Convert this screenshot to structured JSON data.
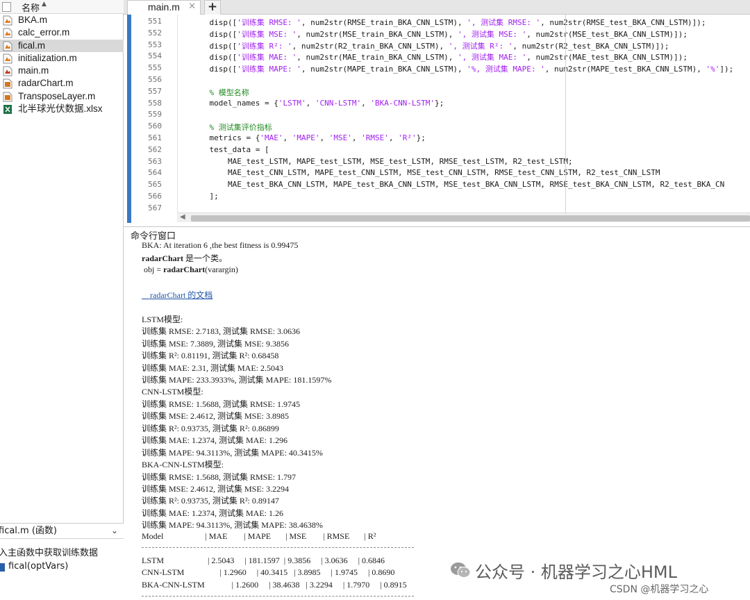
{
  "file_browser": {
    "header": "名称",
    "files": [
      {
        "name": "BKA.m",
        "icon": "matlab-file-icon"
      },
      {
        "name": "calc_error.m",
        "icon": "matlab-file-icon"
      },
      {
        "name": "fical.m",
        "icon": "matlab-file-icon",
        "selected": true
      },
      {
        "name": "initialization.m",
        "icon": "matlab-file-icon"
      },
      {
        "name": "main.m",
        "icon": "matlab-script-icon"
      },
      {
        "name": "radarChart.m",
        "icon": "matlab-class-icon"
      },
      {
        "name": "TransposeLayer.m",
        "icon": "matlab-class-icon"
      },
      {
        "name": "北半球光伏数据.xlsx",
        "icon": "excel-file-icon"
      }
    ]
  },
  "func_panel": {
    "title": "fical.m  (函数)",
    "description": "入主函数中获取训练数据",
    "signature": "fical(optVars)"
  },
  "editor": {
    "tab": "main.m",
    "add_tab": "+",
    "lines": [
      {
        "num": "551",
        "segs": [
          {
            "t": "    disp(["
          },
          {
            "t": "'训练集 RMSE: '",
            "c": "str"
          },
          {
            "t": ", num2str(RMSE_train_BKA_CNN_LSTM), "
          },
          {
            "t": "', 测试集 RMSE: '",
            "c": "str"
          },
          {
            "t": ", num2str(RMSE_test_BKA_CNN_LSTM)]);"
          }
        ]
      },
      {
        "num": "552",
        "segs": [
          {
            "t": "    disp(["
          },
          {
            "t": "'训练集 MSE: '",
            "c": "str"
          },
          {
            "t": ", num2str(MSE_train_BKA_CNN_LSTM), "
          },
          {
            "t": "', 测试集 MSE: '",
            "c": "str"
          },
          {
            "t": ", num2str(MSE_test_BKA_CNN_LSTM)]);"
          }
        ]
      },
      {
        "num": "553",
        "segs": [
          {
            "t": "    disp(["
          },
          {
            "t": "'训练集 R²: '",
            "c": "str"
          },
          {
            "t": ", num2str(R2_train_BKA_CNN_LSTM), "
          },
          {
            "t": "', 测试集 R²: '",
            "c": "str"
          },
          {
            "t": ", num2str(R2_test_BKA_CNN_LSTM)]);"
          }
        ]
      },
      {
        "num": "554",
        "segs": [
          {
            "t": "    disp(["
          },
          {
            "t": "'训练集 MAE: '",
            "c": "str"
          },
          {
            "t": ", num2str(MAE_train_BKA_CNN_LSTM), "
          },
          {
            "t": "', 测试集 MAE: '",
            "c": "str"
          },
          {
            "t": ", num2str(MAE_test_BKA_CNN_LSTM)]);"
          }
        ]
      },
      {
        "num": "555",
        "segs": [
          {
            "t": "    disp(["
          },
          {
            "t": "'训练集 MAPE: '",
            "c": "str"
          },
          {
            "t": ", num2str(MAPE_train_BKA_CNN_LSTM), "
          },
          {
            "t": "'%, 测试集 MAPE: '",
            "c": "str"
          },
          {
            "t": ", num2str(MAPE_test_BKA_CNN_LSTM), "
          },
          {
            "t": "'%'",
            "c": "str"
          },
          {
            "t": "]);"
          }
        ]
      },
      {
        "num": "556",
        "segs": [
          {
            "t": ""
          }
        ]
      },
      {
        "num": "557",
        "segs": [
          {
            "t": "    "
          },
          {
            "t": "% 模型名称",
            "c": "cm"
          }
        ]
      },
      {
        "num": "558",
        "segs": [
          {
            "t": "    model_names = {"
          },
          {
            "t": "'LSTM'",
            "c": "str"
          },
          {
            "t": ", "
          },
          {
            "t": "'CNN-LSTM'",
            "c": "str"
          },
          {
            "t": ", "
          },
          {
            "t": "'BKA-CNN-LSTM'",
            "c": "str"
          },
          {
            "t": "};"
          }
        ]
      },
      {
        "num": "559",
        "segs": [
          {
            "t": ""
          }
        ]
      },
      {
        "num": "560",
        "segs": [
          {
            "t": "    "
          },
          {
            "t": "% 测试集评价指标",
            "c": "cm"
          }
        ]
      },
      {
        "num": "561",
        "segs": [
          {
            "t": "    metrics = {"
          },
          {
            "t": "'MAE'",
            "c": "str"
          },
          {
            "t": ", "
          },
          {
            "t": "'MAPE'",
            "c": "str"
          },
          {
            "t": ", "
          },
          {
            "t": "'MSE'",
            "c": "str"
          },
          {
            "t": ", "
          },
          {
            "t": "'RMSE'",
            "c": "str"
          },
          {
            "t": ", "
          },
          {
            "t": "'R²'",
            "c": "str"
          },
          {
            "t": "};"
          }
        ]
      },
      {
        "num": "562",
        "segs": [
          {
            "t": "    test_data = ["
          }
        ]
      },
      {
        "num": "563",
        "segs": [
          {
            "t": "        MAE_test_LSTM, MAPE_test_LSTM, MSE_test_LSTM, RMSE_test_LSTM, R2_test_LSTM;"
          }
        ]
      },
      {
        "num": "564",
        "segs": [
          {
            "t": "        MAE_test_CNN_LSTM, MAPE_test_CNN_LSTM, MSE_test_CNN_LSTM, RMSE_test_CNN_LSTM, R2_test_CNN_LSTM"
          }
        ]
      },
      {
        "num": "565",
        "segs": [
          {
            "t": "        MAE_test_BKA_CNN_LSTM, MAPE_test_BKA_CNN_LSTM, MSE_test_BKA_CNN_LSTM, RMSE_test_BKA_CNN_LSTM, R2_test_BKA_CN"
          }
        ]
      },
      {
        "num": "566",
        "segs": [
          {
            "t": "    ];"
          }
        ]
      },
      {
        "num": "567",
        "segs": [
          {
            "t": ""
          }
        ]
      }
    ]
  },
  "command_window": {
    "title": "命令行窗口",
    "lines": [
      {
        "segs": [
          {
            "t": "BKA: At iteration 6 ,the best fitness is 0.99475"
          }
        ]
      },
      {
        "segs": [
          {
            "t": "radarChart",
            "b": true
          },
          {
            "t": " 是一个类。"
          }
        ]
      },
      {
        "segs": [
          {
            "t": " obj = "
          },
          {
            "t": "radarChart",
            "b": true
          },
          {
            "t": "(varargin)"
          }
        ]
      },
      {
        "segs": [
          {
            "t": ""
          }
        ]
      },
      {
        "segs": [
          {
            "t": "    radarChart 的文档"
          }
        ],
        "link": true
      },
      {
        "segs": [
          {
            "t": ""
          }
        ]
      },
      {
        "segs": [
          {
            "t": "LSTM模型:"
          }
        ]
      },
      {
        "segs": [
          {
            "t": "训练集 RMSE: 2.7183, 测试集 RMSE: 3.0636"
          }
        ]
      },
      {
        "segs": [
          {
            "t": "训练集 MSE: 7.3889, 测试集 MSE: 9.3856"
          }
        ]
      },
      {
        "segs": [
          {
            "t": "训练集 R²: 0.81191, 测试集 R²: 0.68458"
          }
        ]
      },
      {
        "segs": [
          {
            "t": "训练集 MAE: 2.31, 测试集 MAE: 2.5043"
          }
        ]
      },
      {
        "segs": [
          {
            "t": "训练集 MAPE: 233.3933%, 测试集 MAPE: 181.1597%"
          }
        ]
      },
      {
        "segs": [
          {
            "t": "CNN-LSTM模型:"
          }
        ]
      },
      {
        "segs": [
          {
            "t": "训练集 RMSE: 1.5688, 测试集 RMSE: 1.9745"
          }
        ]
      },
      {
        "segs": [
          {
            "t": "训练集 MSE: 2.4612, 测试集 MSE: 3.8985"
          }
        ]
      },
      {
        "segs": [
          {
            "t": "训练集 R²: 0.93735, 测试集 R²: 0.86899"
          }
        ]
      },
      {
        "segs": [
          {
            "t": "训练集 MAE: 1.2374, 测试集 MAE: 1.296"
          }
        ]
      },
      {
        "segs": [
          {
            "t": "训练集 MAPE: 94.3113%, 测试集 MAPE: 40.3415%"
          }
        ]
      },
      {
        "segs": [
          {
            "t": "BKA-CNN-LSTM模型:"
          }
        ]
      },
      {
        "segs": [
          {
            "t": "训练集 RMSE: 1.5688, 测试集 RMSE: 1.797"
          }
        ]
      },
      {
        "segs": [
          {
            "t": "训练集 MSE: 2.4612, 测试集 MSE: 3.2294"
          }
        ]
      },
      {
        "segs": [
          {
            "t": "训练集 R²: 0.93735, 测试集 R²: 0.89147"
          }
        ]
      },
      {
        "segs": [
          {
            "t": "训练集 MAE: 1.2374, 测试集 MAE: 1.26"
          }
        ]
      },
      {
        "segs": [
          {
            "t": "训练集 MAPE: 94.3113%, 测试集 MAPE: 38.4638%"
          }
        ]
      },
      {
        "segs": [
          {
            "t": "Model                    | MAE        | MAPE       | MSE        | RMSE       | R²"
          }
        ]
      },
      {
        "segs": [
          {
            "t": ""
          }
        ],
        "sep": true
      },
      {
        "segs": [
          {
            "t": "LSTM                     | 2.5043     | 181.1597  | 9.3856     | 3.0636     | 0.6846"
          }
        ]
      },
      {
        "segs": [
          {
            "t": "CNN-LSTM                 | 1.2960     | 40.3415   | 3.8985     | 1.9745     | 0.8690"
          }
        ]
      },
      {
        "segs": [
          {
            "t": "BKA-CNN-LSTM             | 1.2600     | 38.4638   | 3.2294     | 1.7970     | 0.8915"
          }
        ]
      },
      {
        "segs": [
          {
            "t": ""
          }
        ],
        "sep": true
      }
    ]
  },
  "watermark": {
    "text": "公众号 · 机器学习之心HML",
    "credit": "CSDN @机器学习之心"
  }
}
